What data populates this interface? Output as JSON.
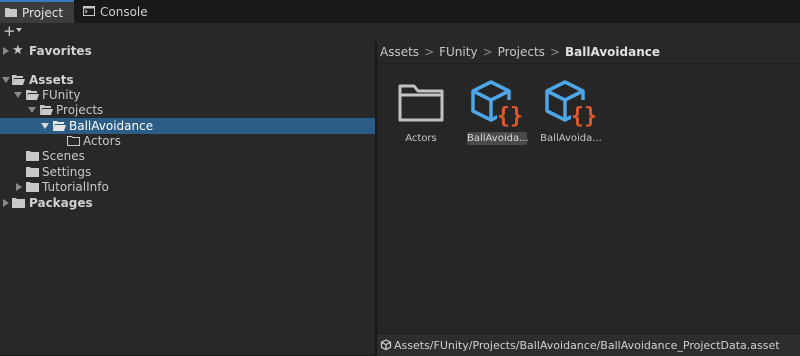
{
  "tabs": [
    {
      "label": "Project",
      "icon": "folder-icon",
      "active": true
    },
    {
      "label": "Console",
      "icon": "console-icon",
      "active": false
    }
  ],
  "toolbar": {
    "add_label": "+"
  },
  "tree": {
    "favorites": "Favorites",
    "assets": "Assets",
    "funity": "FUnity",
    "projects": "Projects",
    "ballavoidance": "BallAvoidance",
    "actors": "Actors",
    "scenes": "Scenes",
    "settings": "Settings",
    "tutorialinfo": "TutorialInfo",
    "packages": "Packages"
  },
  "breadcrumb": [
    "Assets",
    "FUnity",
    "Projects",
    "BallAvoidance"
  ],
  "breadcrumb_separator": ">",
  "grid": [
    {
      "name": "Actors",
      "type": "folder",
      "selected": false
    },
    {
      "name": "BallAvoida...",
      "type": "script-asset",
      "selected": true
    },
    {
      "name": "BallAvoida...",
      "type": "script-asset",
      "selected": false
    }
  ],
  "status": {
    "path": "Assets/FUnity/Projects/BallAvoidance/BallAvoidance_ProjectData.asset"
  },
  "colors": {
    "selection": "#2c5d87",
    "cube_blue": "#4fa7e8",
    "braces_orange": "#e0582e",
    "folder_gray": "#c2c2c2"
  }
}
